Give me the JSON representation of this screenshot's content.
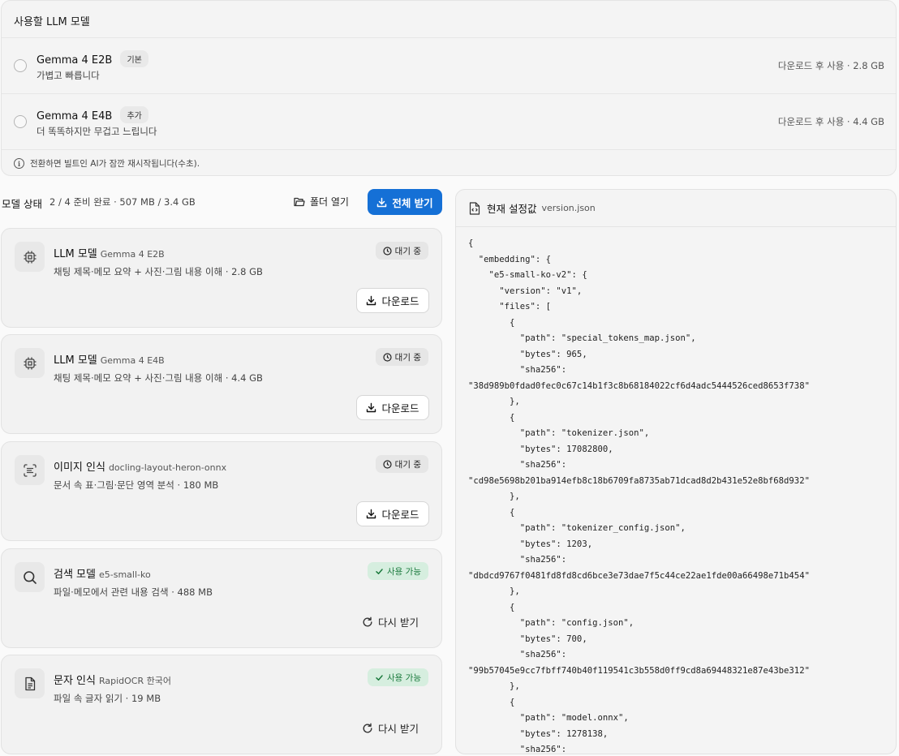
{
  "llm_section": {
    "title": "사용할 LLM 모델",
    "options": [
      {
        "name": "Gemma 4 E2B",
        "tag": "기본",
        "desc": "가볍고 빠릅니다",
        "size": "다운로드 후 사용 · 2.8 GB"
      },
      {
        "name": "Gemma 4 E4B",
        "tag": "추가",
        "desc": "더 똑똑하지만 무겁고 느립니다",
        "size": "다운로드 후 사용 · 4.4 GB"
      }
    ],
    "note": "전환하면 빌트인 AI가 잠깐 재시작됩니다(수초)."
  },
  "status": {
    "title": "모델 상태",
    "summary": "2 / 4 준비 완료 · 507 MB / 3.4 GB",
    "open_folder": "폴더 열기",
    "download_all": "전체 받기"
  },
  "models": [
    {
      "title": "LLM 모델",
      "subtitle": "Gemma 4 E2B",
      "desc": "채팅 제목·메모 요약 + 사진·그림 내용 이해 · 2.8 GB",
      "status": "대기 중",
      "action": "다운로드",
      "icon": "chip-icon"
    },
    {
      "title": "LLM 모델",
      "subtitle": "Gemma 4 E4B",
      "desc": "채팅 제목·메모 요약 + 사진·그림 내용 이해 · 4.4 GB",
      "status": "대기 중",
      "action": "다운로드",
      "icon": "chip-icon"
    },
    {
      "title": "이미지 인식",
      "subtitle": "docling-layout-heron-onnx",
      "desc": "문서 속 표·그림·문단 영역 분석 · 180 MB",
      "status": "대기 중",
      "action": "다운로드",
      "icon": "scan-text-icon"
    },
    {
      "title": "검색 모델",
      "subtitle": "e5-small-ko",
      "desc": "파일·메모에서 관련 내용 검색 · 488 MB",
      "status": "사용 가능",
      "action": "다시 받기",
      "icon": "search-icon"
    },
    {
      "title": "문자 인식",
      "subtitle": "RapidOCR 한국어",
      "desc": "파일 속 글자 읽기 · 19 MB",
      "status": "사용 가능",
      "action": "다시 받기",
      "icon": "file-text-icon"
    }
  ],
  "config": {
    "title": "현재 설정값",
    "file": "version.json",
    "content": "{\n  \"embedding\": {\n    \"e5-small-ko-v2\": {\n      \"version\": \"v1\",\n      \"files\": [\n        {\n          \"path\": \"special_tokens_map.json\",\n          \"bytes\": 965,\n          \"sha256\":\n\"38d989b0fdad0fec0c67c14b1f3c8b68184022cf6d4adc5444526ced8653f738\"\n        },\n        {\n          \"path\": \"tokenizer.json\",\n          \"bytes\": 17082800,\n          \"sha256\":\n\"cd98e5698b201ba914efb8c18b6709fa8735ab71dcad8d2b431e52e8bf68d932\"\n        },\n        {\n          \"path\": \"tokenizer_config.json\",\n          \"bytes\": 1203,\n          \"sha256\":\n\"dbdcd9767f0481fd8fd8cd6bce3e73dae7f5c44ce22ae1fde00a66498e71b454\"\n        },\n        {\n          \"path\": \"config.json\",\n          \"bytes\": 700,\n          \"sha256\":\n\"99b57045e9cc7fbff740b40f119541c3b558d0ff9cd8a69448321e87e43be312\"\n        },\n        {\n          \"path\": \"model.onnx\",\n          \"bytes\": 1278138,\n          \"sha256\":"
  },
  "colors": {
    "accent": "#1570d6",
    "ready_bg": "#d6eedf",
    "ready_text": "#1b7a3d"
  }
}
